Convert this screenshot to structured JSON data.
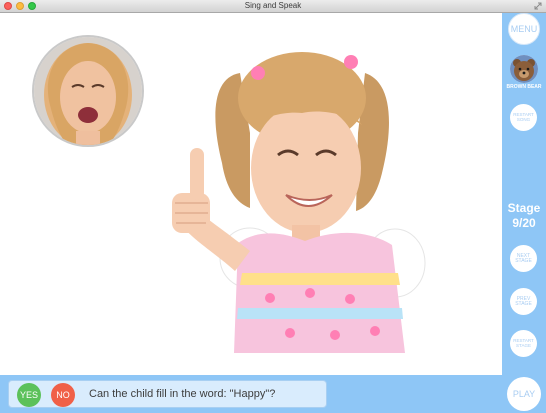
{
  "window": {
    "title": "Sing and Speak"
  },
  "main": {
    "presenter_video": "presenter-face",
    "picture": "smiling-girl-thumbs-up"
  },
  "sidebar": {
    "menu_label": "MENU",
    "song_name": "BROWN BEAR",
    "restart_song_label": "RESTART SONG",
    "stage_title": "Stage",
    "stage_count": "9/20",
    "next_stage_label": "NEXT STAGE",
    "prev_stage_label": "PREV STAGE",
    "restart_stage_label": "RESTART STAGE",
    "play_label": "PLAY"
  },
  "bottom": {
    "yes_label": "YES",
    "no_label": "NO",
    "question": "Can the child fill in the word: \"Happy\"?"
  },
  "colors": {
    "accent": "#8ec6f6",
    "yes": "#5cc15a",
    "no": "#f06048",
    "panel": "#d9ecfd"
  }
}
